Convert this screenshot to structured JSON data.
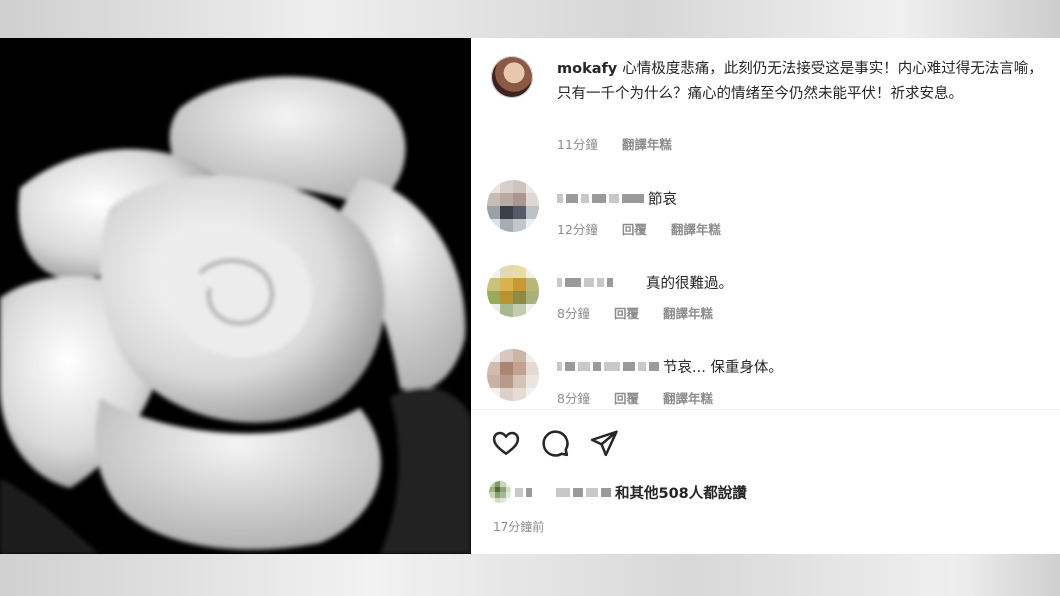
{
  "post": {
    "username": "mokafy",
    "caption": "心情极度悲痛，此刻仍无法接受这是事实！内心难过得无法言喻，只有一千个为什么？痛心的情绪至今仍然未能平伏！祈求安息。",
    "caption_time": "11分鐘",
    "caption_translate": "翻譯年糕"
  },
  "comments": [
    {
      "text": "節哀",
      "time": "12分鐘",
      "reply": "回覆",
      "translate": "翻譯年糕"
    },
    {
      "text": "真的很難過。",
      "time": "8分鐘",
      "reply": "回覆",
      "translate": "翻譯年糕"
    },
    {
      "text": "节哀... 保重身体。",
      "time": "8分鐘",
      "reply": "回覆",
      "translate": "翻譯年糕"
    }
  ],
  "actions": {
    "like_icon": "heart-icon",
    "comment_icon": "comment-icon",
    "share_icon": "share-icon"
  },
  "likes": {
    "text": "和其他508人都說讚"
  },
  "post_time": "17分鐘前",
  "colors": {
    "text": "#262626",
    "meta": "#8e8e8e",
    "photo_bg": "#000000"
  }
}
